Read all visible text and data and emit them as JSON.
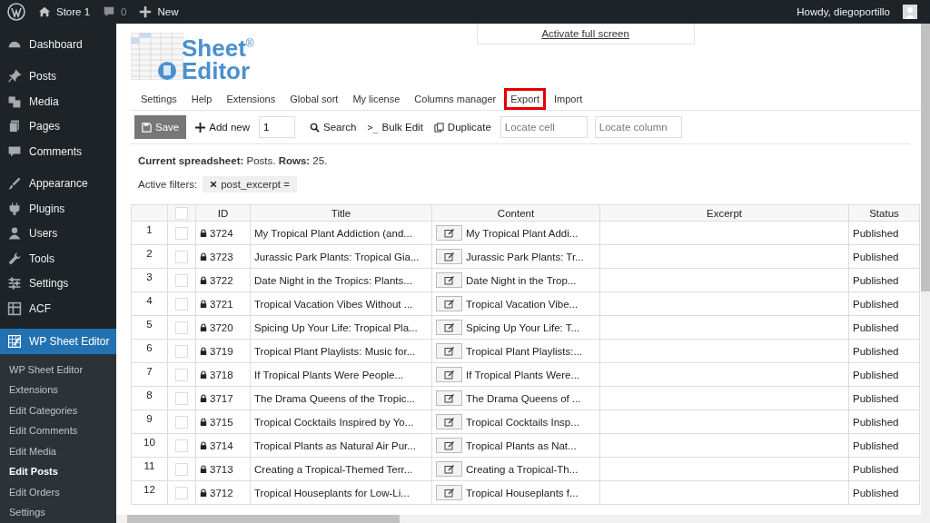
{
  "admin_bar": {
    "site": "Store 1",
    "comments": "0",
    "new": "New",
    "greeting": "Howdy, diegoportillo"
  },
  "sidebar": {
    "items": [
      {
        "label": "Dashboard",
        "selected": false
      },
      {
        "label": "Posts",
        "selected": false
      },
      {
        "label": "Media",
        "selected": false
      },
      {
        "label": "Pages",
        "selected": false
      },
      {
        "label": "Comments",
        "selected": false
      },
      {
        "label": "Appearance",
        "selected": false
      },
      {
        "label": "Plugins",
        "selected": false
      },
      {
        "label": "Users",
        "selected": false
      },
      {
        "label": "Tools",
        "selected": false
      },
      {
        "label": "Settings",
        "selected": false
      },
      {
        "label": "ACF",
        "selected": false
      },
      {
        "label": "WP Sheet Editor",
        "selected": true
      }
    ],
    "submenu": [
      {
        "label": "WP Sheet Editor",
        "selected": false
      },
      {
        "label": "Extensions",
        "selected": false
      },
      {
        "label": "Edit Categories",
        "selected": false
      },
      {
        "label": "Edit Comments",
        "selected": false
      },
      {
        "label": "Edit Media",
        "selected": false
      },
      {
        "label": "Edit Posts",
        "selected": true
      },
      {
        "label": "Edit Orders",
        "selected": false
      },
      {
        "label": "Settings",
        "selected": false
      }
    ]
  },
  "logo": {
    "line1": "Sheet",
    "line2": "Editor",
    "mark": "®"
  },
  "fullscreen_link": "Activate full screen",
  "menu": [
    {
      "label": "Settings",
      "highlighted": false
    },
    {
      "label": "Help",
      "highlighted": false
    },
    {
      "label": "Extensions",
      "highlighted": false
    },
    {
      "label": "Global sort",
      "highlighted": false
    },
    {
      "label": "My license",
      "highlighted": false
    },
    {
      "label": "Columns manager",
      "highlighted": false
    },
    {
      "label": "Export",
      "highlighted": true
    },
    {
      "label": "Import",
      "highlighted": false
    }
  ],
  "toolbar": {
    "save": "Save",
    "add_new": "Add new",
    "count": "1",
    "search": "Search",
    "bulk_edit_icon": ">_",
    "bulk_edit": "Bulk Edit",
    "duplicate": "Duplicate",
    "locate_cell": {
      "placeholder": "Locate cell"
    },
    "locate_column": {
      "placeholder": "Locate column"
    }
  },
  "summary": "**Current spreadsheet:** Posts. **Rows:** 25.",
  "filters": {
    "label": "Active filters:",
    "chips": [
      "post_excerpt ="
    ]
  },
  "table": {
    "header_checked": false,
    "columns": [
      "ID",
      "Title",
      "Content",
      "Excerpt",
      "Status"
    ],
    "rows": [
      {
        "n": "1",
        "checked": false,
        "id": "3724",
        "title": "My Tropical Plant Addiction (and...",
        "content": "My Tropical Plant Addi...",
        "status": "Published"
      },
      {
        "n": "2",
        "checked": false,
        "id": "3723",
        "title": "Jurassic Park Plants: Tropical Gia...",
        "content": "Jurassic Park Plants: Tr...",
        "status": "Published"
      },
      {
        "n": "3",
        "checked": false,
        "id": "3722",
        "title": "Date Night in the Tropics: Plants...",
        "content": "Date Night in the Trop...",
        "status": "Published"
      },
      {
        "n": "4",
        "checked": false,
        "id": "3721",
        "title": "Tropical Vacation Vibes Without ...",
        "content": "Tropical Vacation Vibe...",
        "status": "Published"
      },
      {
        "n": "5",
        "checked": false,
        "id": "3720",
        "title": "Spicing Up Your Life: Tropical Pla...",
        "content": "Spicing Up Your Life: T...",
        "status": "Published"
      },
      {
        "n": "6",
        "checked": false,
        "id": "3719",
        "title": "Tropical Plant Playlists: Music for...",
        "content": "Tropical Plant Playlists:...",
        "status": "Published"
      },
      {
        "n": "7",
        "checked": false,
        "id": "3718",
        "title": "If Tropical Plants Were People...",
        "content": "If Tropical Plants Were...",
        "status": "Published"
      },
      {
        "n": "8",
        "checked": false,
        "id": "3717",
        "title": "The Drama Queens of the Tropic...",
        "content": "The Drama Queens of ...",
        "status": "Published"
      },
      {
        "n": "9",
        "checked": false,
        "id": "3715",
        "title": "Tropical Cocktails Inspired by Yo...",
        "content": "Tropical Cocktails Insp...",
        "status": "Published"
      },
      {
        "n": "10",
        "checked": false,
        "id": "3714",
        "title": "Tropical Plants as Natural Air Pur...",
        "content": "Tropical Plants as Nat...",
        "status": "Published"
      },
      {
        "n": "11",
        "checked": false,
        "id": "3713",
        "title": "Creating a Tropical-Themed Terr...",
        "content": "Creating a Tropical-Th...",
        "status": "Published"
      },
      {
        "n": "12",
        "checked": false,
        "id": "3712",
        "title": "Tropical Houseplants for Low-Li...",
        "content": "Tropical Houseplants f...",
        "status": "Published"
      }
    ]
  }
}
